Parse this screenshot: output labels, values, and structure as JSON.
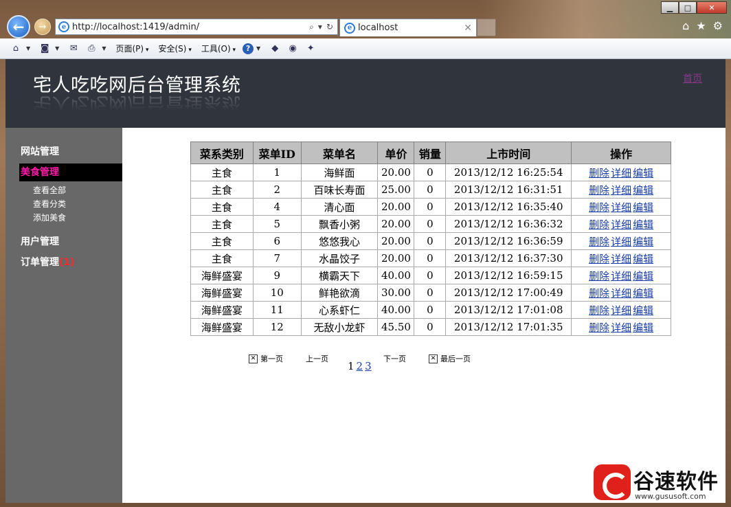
{
  "browser": {
    "url": "http://localhost:1419/admin/",
    "tab_title": "localhost",
    "menus": [
      "页面(P)",
      "安全(S)",
      "工具(O)"
    ]
  },
  "header": {
    "title": "宅人吃吃网后台管理系统",
    "home_link": "首页"
  },
  "sidebar": {
    "groups": [
      {
        "label": "网站管理",
        "active": false
      },
      {
        "label": "美食管理",
        "active": true,
        "items": [
          "查看全部",
          "查看分类",
          "添加美食"
        ]
      },
      {
        "label": "用户管理",
        "active": false
      },
      {
        "label": "订单管理",
        "badge": "(1)",
        "active": false
      }
    ]
  },
  "table": {
    "headers": [
      "菜系类别",
      "菜单ID",
      "菜单名",
      "单价",
      "销量",
      "上市时间",
      "操作"
    ],
    "op_labels": [
      "删除",
      "详细",
      "编辑"
    ],
    "rows": [
      [
        "主食",
        "1",
        "海鲜面",
        "20.00",
        "0",
        "2013/12/12 16:25:54"
      ],
      [
        "主食",
        "2",
        "百味长寿面",
        "25.00",
        "0",
        "2013/12/12 16:31:51"
      ],
      [
        "主食",
        "4",
        "清心面",
        "20.00",
        "0",
        "2013/12/12 16:35:40"
      ],
      [
        "主食",
        "5",
        "飘香小粥",
        "20.00",
        "0",
        "2013/12/12 16:36:32"
      ],
      [
        "主食",
        "6",
        "悠悠我心",
        "20.00",
        "0",
        "2013/12/12 16:36:59"
      ],
      [
        "主食",
        "7",
        "水晶饺子",
        "20.00",
        "0",
        "2013/12/12 16:37:30"
      ],
      [
        "海鲜盛宴",
        "9",
        "横霸天下",
        "40.00",
        "0",
        "2013/12/12 16:59:15"
      ],
      [
        "海鲜盛宴",
        "10",
        "鲜艳欲滴",
        "30.00",
        "0",
        "2013/12/12 17:00:49"
      ],
      [
        "海鲜盛宴",
        "11",
        "心系虾仁",
        "40.00",
        "0",
        "2013/12/12 17:01:08"
      ],
      [
        "海鲜盛宴",
        "12",
        "无敌小龙虾",
        "45.50",
        "0",
        "2013/12/12 17:01:35"
      ]
    ]
  },
  "pager": {
    "first": "第一页",
    "prev": "上一页",
    "next": "下一页",
    "last": "最后一页",
    "current": "1",
    "pages": [
      "2",
      "3"
    ]
  },
  "watermark": {
    "text": "谷速软件",
    "url": "www.gususoft.com"
  }
}
